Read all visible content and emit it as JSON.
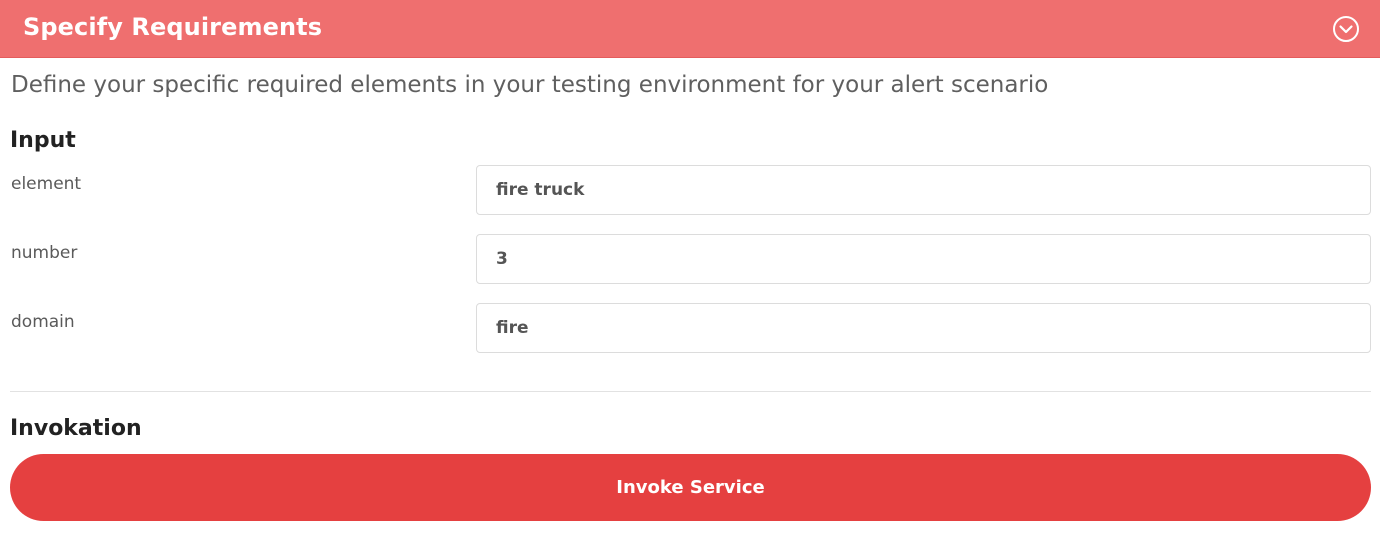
{
  "header": {
    "title": "Specify Requirements",
    "toggle_icon": "chevron-down-circle-icon",
    "background_color": "#ef6f6f"
  },
  "description": "Define your specific required elements in your testing environment for your alert scenario",
  "input_section": {
    "heading": "Input",
    "fields": [
      {
        "label": "element",
        "value": "fire truck"
      },
      {
        "label": "number",
        "value": "3"
      },
      {
        "label": "domain",
        "value": "fire"
      }
    ]
  },
  "invocation_section": {
    "heading": "Invokation",
    "button_label": "Invoke Service",
    "button_color": "#e54040"
  }
}
